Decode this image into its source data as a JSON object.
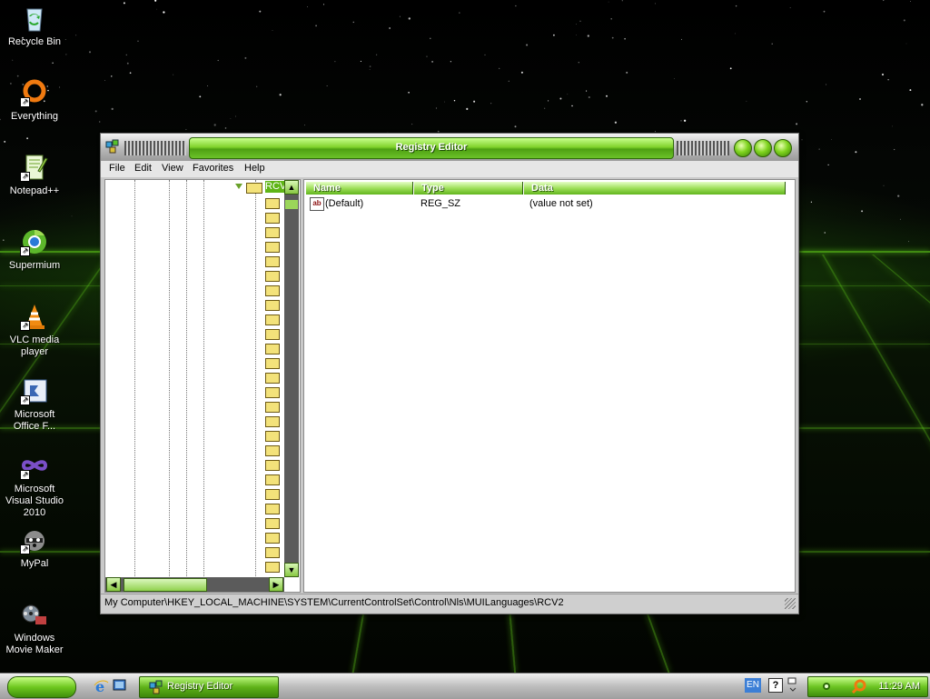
{
  "desktop": {
    "icons": [
      {
        "label": "Recycle Bin",
        "icon": "recycle-bin-icon"
      },
      {
        "label": "Everything",
        "icon": "everything-search-icon"
      },
      {
        "label": "Notepad++",
        "icon": "notepad-plus-plus-icon"
      },
      {
        "label": "Supermium",
        "icon": "supermium-browser-icon"
      },
      {
        "label": "VLC media player",
        "icon": "vlc-cone-icon"
      },
      {
        "label": "Microsoft Office F...",
        "icon": "office-frontpage-icon"
      },
      {
        "label": "Microsoft Visual Studio 2010",
        "icon": "visual-studio-infinity-icon"
      },
      {
        "label": "MyPal",
        "icon": "mypal-raccoon-icon"
      },
      {
        "label": "Windows Movie Maker",
        "icon": "movie-maker-film-icon"
      }
    ]
  },
  "window": {
    "title": "Registry Editor",
    "menu": [
      "File",
      "Edit",
      "View",
      "Favorites",
      "Help"
    ],
    "tree": {
      "selected_key": "RCV2",
      "folder_count": 26
    },
    "list": {
      "columns": [
        "Name",
        "Type",
        "Data"
      ],
      "rows": [
        {
          "name": "(Default)",
          "type": "REG_SZ",
          "data": "(value not set)"
        }
      ]
    },
    "status_path": "My Computer\\HKEY_LOCAL_MACHINE\\SYSTEM\\CurrentControlSet\\Control\\Nls\\MUILanguages\\RCV2"
  },
  "taskbar": {
    "task_button": "Registry Editor",
    "language": "EN",
    "clock": "11:29 AM"
  },
  "colors": {
    "accent_green": "#6ec81f",
    "dark_green": "#2b5e08",
    "chrome_gray": "#c9c9c9"
  }
}
